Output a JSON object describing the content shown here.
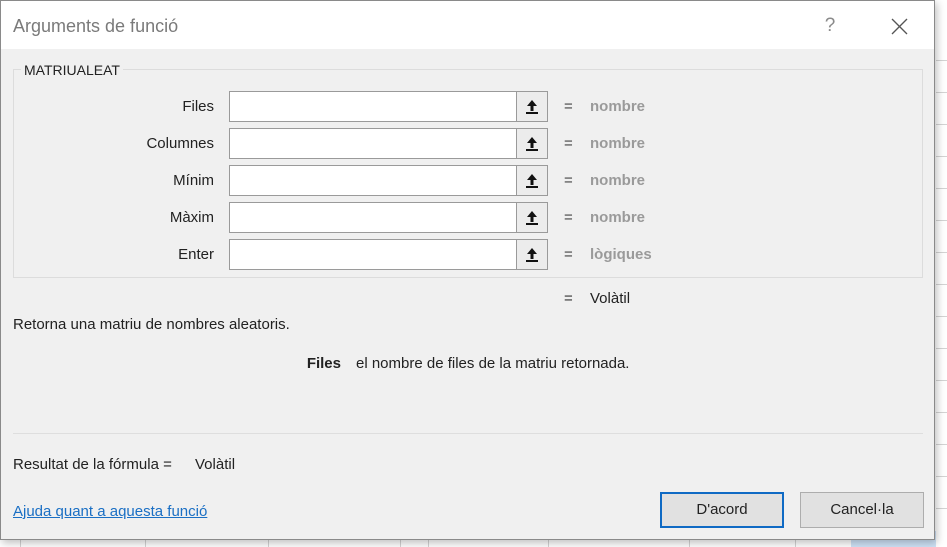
{
  "dialog": {
    "title": "Arguments de funció",
    "help_glyph": "?",
    "function_name": "MATRIUALEAT",
    "arguments": [
      {
        "label": "Files",
        "value": "",
        "type": "nombre"
      },
      {
        "label": "Columnes",
        "value": "",
        "type": "nombre"
      },
      {
        "label": "Mínim",
        "value": "",
        "type": "nombre"
      },
      {
        "label": "Màxim",
        "value": "",
        "type": "nombre"
      },
      {
        "label": "Enter",
        "value": "",
        "type": "lògiques"
      }
    ],
    "equals": "=",
    "result_value": "Volàtil",
    "description": "Retorna una matriu de nombres aleatoris.",
    "arg_help": {
      "name": "Files",
      "text": "el nombre de files de la matriu retornada."
    },
    "formula_result_label": "Resultat de la fórmula =",
    "formula_result_value": "Volàtil",
    "help_link": "Ajuda quant a aquesta funció",
    "ok_label": "D'acord",
    "cancel_label": "Cancel·la"
  },
  "colors": {
    "accent": "#0f6ac4",
    "link": "#1a6fc4",
    "type_text": "#9a9a9a",
    "dialog_bg": "#f0f0f0"
  }
}
